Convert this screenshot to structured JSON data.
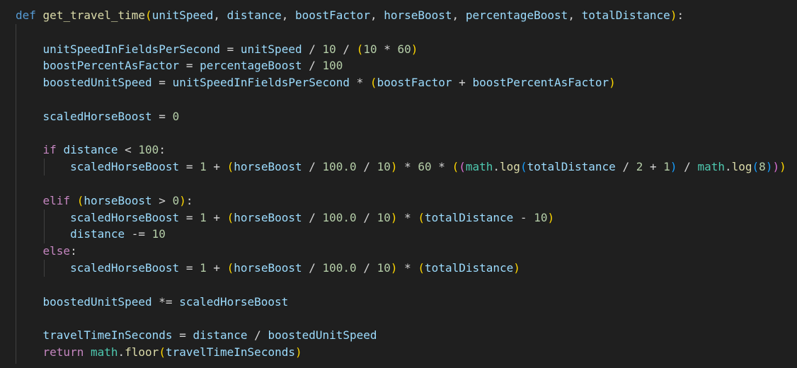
{
  "colors": {
    "background": "#1f1f1f",
    "indent_guide": "#404040",
    "keyword": "#569cd6",
    "control": "#c586c0",
    "function": "#dcdcaa",
    "variable": "#9cdcfe",
    "number": "#b5cea8",
    "operator": "#d4d4d4",
    "class": "#4ec9b0",
    "bracket1": "#ffd700",
    "bracket2": "#da70d6",
    "bracket3": "#179fff"
  },
  "code": [
    [
      [
        "def",
        "kw"
      ],
      [
        " ",
        "op"
      ],
      [
        "get_travel_time",
        "fn"
      ],
      [
        "(",
        "b1"
      ],
      [
        "unitSpeed",
        "var"
      ],
      [
        ", ",
        "op"
      ],
      [
        "distance",
        "var"
      ],
      [
        ", ",
        "op"
      ],
      [
        "boostFactor",
        "var"
      ],
      [
        ", ",
        "op"
      ],
      [
        "horseBoost",
        "var"
      ],
      [
        ", ",
        "op"
      ],
      [
        "percentageBoost",
        "var"
      ],
      [
        ", ",
        "op"
      ],
      [
        "totalDistance",
        "var"
      ],
      [
        ")",
        "b1"
      ],
      [
        ":",
        "op"
      ]
    ],
    [],
    [
      [
        "    ",
        "op"
      ],
      [
        "unitSpeedInFieldsPerSecond",
        "var"
      ],
      [
        " = ",
        "op"
      ],
      [
        "unitSpeed",
        "var"
      ],
      [
        " / ",
        "op"
      ],
      [
        "10",
        "num"
      ],
      [
        " / ",
        "op"
      ],
      [
        "(",
        "b1"
      ],
      [
        "10",
        "num"
      ],
      [
        " * ",
        "op"
      ],
      [
        "60",
        "num"
      ],
      [
        ")",
        "b1"
      ]
    ],
    [
      [
        "    ",
        "op"
      ],
      [
        "boostPercentAsFactor",
        "var"
      ],
      [
        " = ",
        "op"
      ],
      [
        "percentageBoost",
        "var"
      ],
      [
        " / ",
        "op"
      ],
      [
        "100",
        "num"
      ]
    ],
    [
      [
        "    ",
        "op"
      ],
      [
        "boostedUnitSpeed",
        "var"
      ],
      [
        " = ",
        "op"
      ],
      [
        "unitSpeedInFieldsPerSecond",
        "var"
      ],
      [
        " * ",
        "op"
      ],
      [
        "(",
        "b1"
      ],
      [
        "boostFactor",
        "var"
      ],
      [
        " + ",
        "op"
      ],
      [
        "boostPercentAsFactor",
        "var"
      ],
      [
        ")",
        "b1"
      ]
    ],
    [],
    [
      [
        "    ",
        "op"
      ],
      [
        "scaledHorseBoost",
        "var"
      ],
      [
        " = ",
        "op"
      ],
      [
        "0",
        "num"
      ]
    ],
    [],
    [
      [
        "    ",
        "op"
      ],
      [
        "if",
        "ctl"
      ],
      [
        " ",
        "op"
      ],
      [
        "distance",
        "var"
      ],
      [
        " < ",
        "op"
      ],
      [
        "100",
        "num"
      ],
      [
        ":",
        "op"
      ]
    ],
    [
      [
        "        ",
        "op"
      ],
      [
        "scaledHorseBoost",
        "var"
      ],
      [
        " = ",
        "op"
      ],
      [
        "1",
        "num"
      ],
      [
        " + ",
        "op"
      ],
      [
        "(",
        "b1"
      ],
      [
        "horseBoost",
        "var"
      ],
      [
        " / ",
        "op"
      ],
      [
        "100.0",
        "num"
      ],
      [
        " / ",
        "op"
      ],
      [
        "10",
        "num"
      ],
      [
        ")",
        "b1"
      ],
      [
        " * ",
        "op"
      ],
      [
        "60",
        "num"
      ],
      [
        " * ",
        "op"
      ],
      [
        "(",
        "b1"
      ],
      [
        "(",
        "b2"
      ],
      [
        "math",
        "cls"
      ],
      [
        ".",
        "op"
      ],
      [
        "log",
        "fn"
      ],
      [
        "(",
        "b3"
      ],
      [
        "totalDistance",
        "var"
      ],
      [
        " / ",
        "op"
      ],
      [
        "2",
        "num"
      ],
      [
        " + ",
        "op"
      ],
      [
        "1",
        "num"
      ],
      [
        ")",
        "b3"
      ],
      [
        " / ",
        "op"
      ],
      [
        "math",
        "cls"
      ],
      [
        ".",
        "op"
      ],
      [
        "log",
        "fn"
      ],
      [
        "(",
        "b3"
      ],
      [
        "8",
        "num"
      ],
      [
        ")",
        "b3"
      ],
      [
        ")",
        "b2"
      ],
      [
        ")",
        "b1"
      ]
    ],
    [],
    [
      [
        "    ",
        "op"
      ],
      [
        "elif",
        "ctl"
      ],
      [
        " ",
        "op"
      ],
      [
        "(",
        "b1"
      ],
      [
        "horseBoost",
        "var"
      ],
      [
        " > ",
        "op"
      ],
      [
        "0",
        "num"
      ],
      [
        ")",
        "b1"
      ],
      [
        ":",
        "op"
      ]
    ],
    [
      [
        "        ",
        "op"
      ],
      [
        "scaledHorseBoost",
        "var"
      ],
      [
        " = ",
        "op"
      ],
      [
        "1",
        "num"
      ],
      [
        " + ",
        "op"
      ],
      [
        "(",
        "b1"
      ],
      [
        "horseBoost",
        "var"
      ],
      [
        " / ",
        "op"
      ],
      [
        "100.0",
        "num"
      ],
      [
        " / ",
        "op"
      ],
      [
        "10",
        "num"
      ],
      [
        ")",
        "b1"
      ],
      [
        " * ",
        "op"
      ],
      [
        "(",
        "b1"
      ],
      [
        "totalDistance",
        "var"
      ],
      [
        " - ",
        "op"
      ],
      [
        "10",
        "num"
      ],
      [
        ")",
        "b1"
      ]
    ],
    [
      [
        "        ",
        "op"
      ],
      [
        "distance",
        "var"
      ],
      [
        " -= ",
        "op"
      ],
      [
        "10",
        "num"
      ]
    ],
    [
      [
        "    ",
        "op"
      ],
      [
        "else",
        "ctl"
      ],
      [
        ":",
        "op"
      ]
    ],
    [
      [
        "        ",
        "op"
      ],
      [
        "scaledHorseBoost",
        "var"
      ],
      [
        " = ",
        "op"
      ],
      [
        "1",
        "num"
      ],
      [
        " + ",
        "op"
      ],
      [
        "(",
        "b1"
      ],
      [
        "horseBoost",
        "var"
      ],
      [
        " / ",
        "op"
      ],
      [
        "100.0",
        "num"
      ],
      [
        " / ",
        "op"
      ],
      [
        "10",
        "num"
      ],
      [
        ")",
        "b1"
      ],
      [
        " * ",
        "op"
      ],
      [
        "(",
        "b1"
      ],
      [
        "totalDistance",
        "var"
      ],
      [
        ")",
        "b1"
      ]
    ],
    [],
    [
      [
        "    ",
        "op"
      ],
      [
        "boostedUnitSpeed",
        "var"
      ],
      [
        " *= ",
        "op"
      ],
      [
        "scaledHorseBoost",
        "var"
      ]
    ],
    [],
    [
      [
        "    ",
        "op"
      ],
      [
        "travelTimeInSeconds",
        "var"
      ],
      [
        " = ",
        "op"
      ],
      [
        "distance",
        "var"
      ],
      [
        " / ",
        "op"
      ],
      [
        "boostedUnitSpeed",
        "var"
      ]
    ],
    [
      [
        "    ",
        "op"
      ],
      [
        "return",
        "ctl"
      ],
      [
        " ",
        "op"
      ],
      [
        "math",
        "cls"
      ],
      [
        ".",
        "op"
      ],
      [
        "floor",
        "fn"
      ],
      [
        "(",
        "b1"
      ],
      [
        "travelTimeInSeconds",
        "var"
      ],
      [
        ")",
        "b1"
      ]
    ]
  ]
}
